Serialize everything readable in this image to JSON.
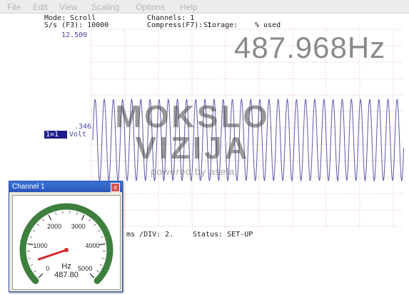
{
  "menu": [
    "File",
    "Edit",
    "View",
    "Scaling",
    "Options",
    "Help"
  ],
  "status": {
    "mode": "Mode: Scroll",
    "sps": "S/s (F3): 10000",
    "channels": "Channels: 1",
    "compress": "Compress(F7): 1",
    "storage": "Storage:",
    "used": "% used"
  },
  "frequency_readout": "487.968Hz",
  "y_axis_max": "12.500",
  "channel": {
    "value": ".346",
    "label": "1=1",
    "unit": "Volt"
  },
  "bottom_status": {
    "ms_div": "ms /DIV: 2.",
    "state": "Status: SET-UP"
  },
  "watermark": {
    "line1": "MOKSLO",
    "line2": "VIZIJA",
    "line3": "powered by asela"
  },
  "gauge": {
    "title": "Channel 1",
    "close_glyph": "x",
    "unit": "Hz",
    "value_text": "487.80",
    "value": 487.8,
    "min": 0,
    "max": 5000,
    "ticks": [
      "0",
      "1000",
      "2000",
      "3000",
      "4000",
      "5000"
    ]
  },
  "colors": {
    "grid": "#e69a9a",
    "trace": "#5a5aa8",
    "gauge_arc": "#3d7f3d",
    "needle": "#d42a2a"
  }
}
